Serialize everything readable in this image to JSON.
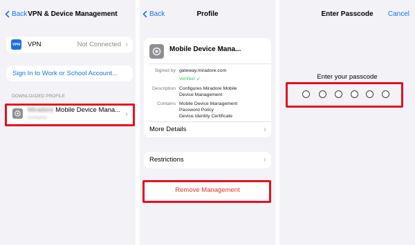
{
  "panel1": {
    "back_label": "Back",
    "title": "VPN & Device Management",
    "vpn": {
      "icon_text": "VPN",
      "label": "VPN",
      "status": "Not Connected"
    },
    "sign_in_label": "Sign In to Work or School Account...",
    "section_header": "DOWNLOADED PROFILE",
    "profile": {
      "name_blurred": "Miradore",
      "name": "Mobile Device Mana...",
      "subtitle_blurred": "Company"
    }
  },
  "panel2": {
    "back_label": "Back",
    "title": "Profile",
    "profile_name": "Mobile Device Mana...",
    "signed_by_label": "Signed by",
    "signed_by_value": "gateway.miradore.com",
    "verified_label": "Verified",
    "description_label": "Description",
    "description_line1": "Configures Miradore Mobile",
    "description_line2": "Device Management",
    "contains_label": "Contains",
    "contains_line1": "Mobile Device Management",
    "contains_line2": "Password Policy",
    "contains_line3": "Device Identity Certificate",
    "more_details_label": "More Details",
    "restrictions_label": "Restrictions",
    "remove_label": "Remove Management"
  },
  "panel3": {
    "title": "Enter Passcode",
    "cancel_label": "Cancel",
    "prompt": "Enter your passcode"
  },
  "colors": {
    "accent": "#1a73e8",
    "destructive": "#e5322d",
    "highlight": "#e3101f",
    "verified": "#34c759"
  }
}
